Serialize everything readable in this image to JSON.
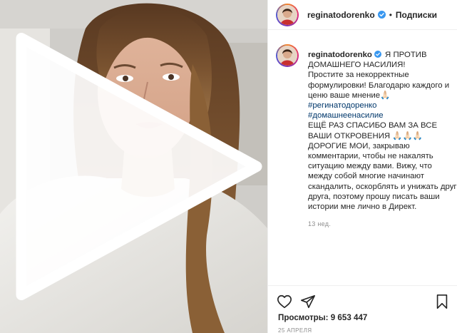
{
  "post": {
    "username": "reginatodorenko",
    "follow_label": "Подписки",
    "separator": "•",
    "caption": {
      "title": "Я ПРОТИВ ДОМАШНЕГО НАСИЛИЯ!",
      "para1": "Простите за некорректные формулировки! Благодарю каждого и ценю ваше мнение🙏🏻",
      "hashtag1": "#регинатодоренко",
      "hashtag2": "#домашнеенасилие",
      "para2": "ЕЩЁ РАЗ СПАСИБО ВАМ ЗА ВСЕ ВАШИ ОТКРОВЕНИЯ 🙏🏻🙏🏻🙏🏻 ДОРОГИЕ МОИ, закрываю комментарии, чтобы не накалять ситуацию между вами. Вижу, что между собой многие начинают скандалить, оскорблять и унижать друг друга, поэтому прошу писать ваши истории мне лично в Директ.",
      "time_ago": "13 нед."
    },
    "views_label": "Просмотры:",
    "views_count": "9 653 447",
    "date": "25 АПРЕЛЯ"
  },
  "icons": {
    "like": "heart-icon",
    "share": "paper-plane-icon",
    "save": "bookmark-icon",
    "play": "play-icon",
    "verified": "verified-badge-icon"
  },
  "colors": {
    "text": "#262626",
    "secondary": "#8e8e8e",
    "hashtag": "#00376b",
    "verified": "#3897f0",
    "border": "#efefef"
  }
}
